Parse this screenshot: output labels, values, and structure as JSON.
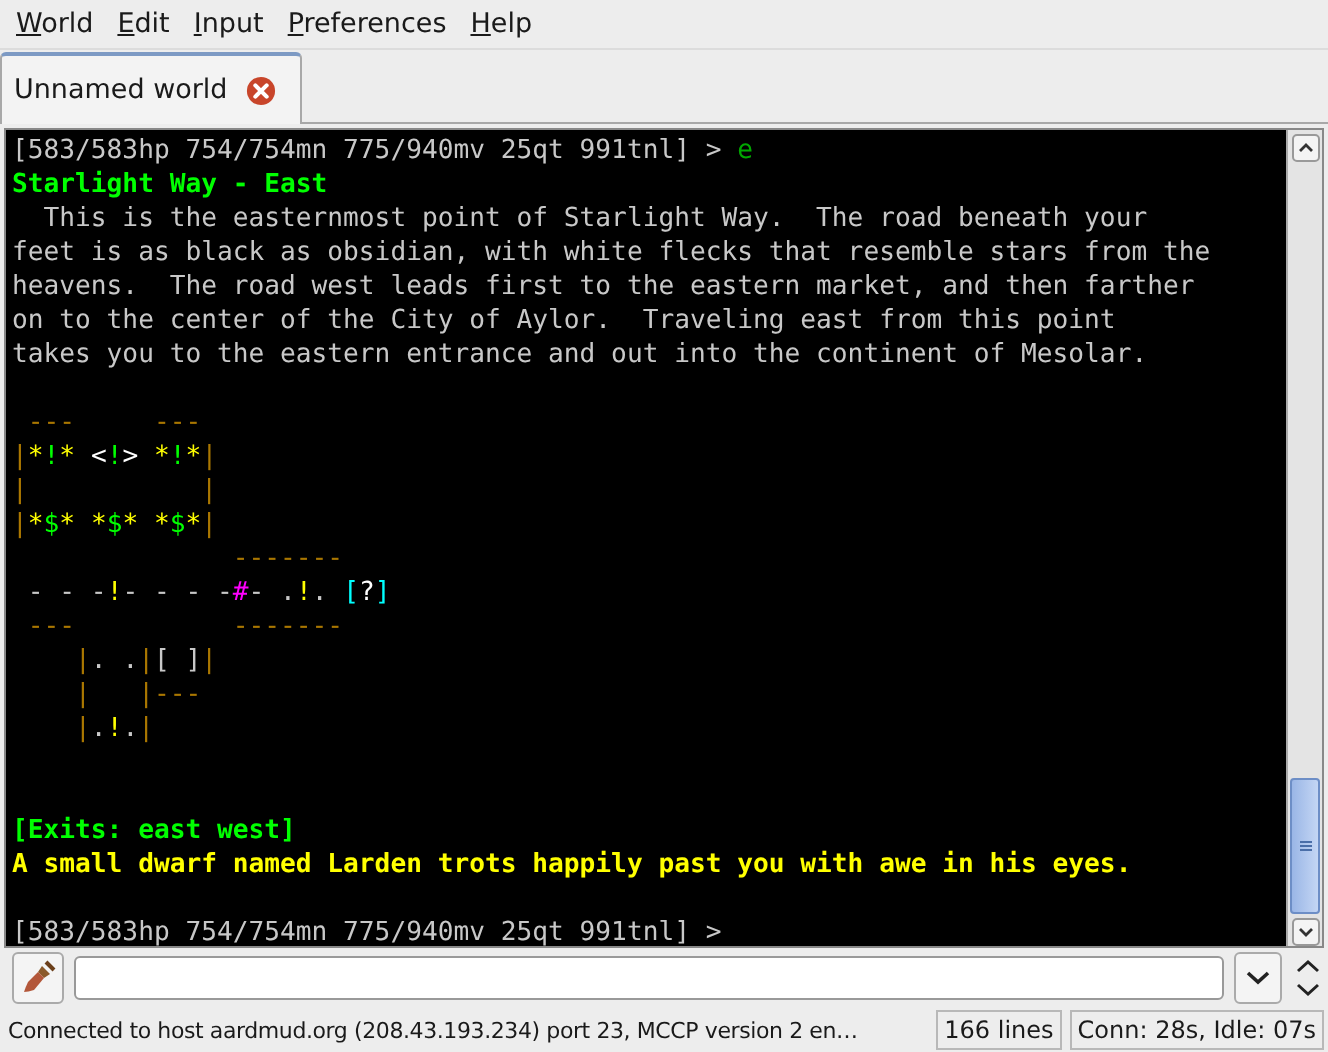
{
  "menu": [
    {
      "label": "World"
    },
    {
      "label": "Edit"
    },
    {
      "label": "Input"
    },
    {
      "label": "Preferences"
    },
    {
      "label": "Help"
    }
  ],
  "tabs": [
    {
      "label": "Unnamed world",
      "selected": true
    }
  ],
  "terminal": {
    "lines": [
      {
        "kind": "text",
        "segments": [
          {
            "text": "[583/583hp 754/754mn 775/940mv 25qt 991tnl] > ",
            "color": "#c8c8c8"
          },
          {
            "text": "e",
            "color": "#00a800"
          }
        ]
      },
      {
        "kind": "text",
        "segments": [
          {
            "text": "Starlight Way - East",
            "color": "#00ff00",
            "bold": true
          }
        ]
      },
      {
        "kind": "text",
        "segments": [
          {
            "text": "  This is the easternmost point of Starlight Way.  The road beneath your",
            "color": "#c8c8c8"
          }
        ]
      },
      {
        "kind": "text",
        "segments": [
          {
            "text": "feet is as black as obsidian, with white flecks that resemble stars from the",
            "color": "#c8c8c8"
          }
        ]
      },
      {
        "kind": "text",
        "segments": [
          {
            "text": "heavens.  The road west leads first to the eastern market, and then farther",
            "color": "#c8c8c8"
          }
        ]
      },
      {
        "kind": "text",
        "segments": [
          {
            "text": "on to the center of the City of Aylor.  Traveling east from this point",
            "color": "#c8c8c8"
          }
        ]
      },
      {
        "kind": "text",
        "segments": [
          {
            "text": "takes you to the eastern entrance and out into the continent of Mesolar.",
            "color": "#c8c8c8"
          }
        ]
      },
      {
        "kind": "blank"
      },
      {
        "kind": "text",
        "segments": [
          {
            "text": " ---     ---",
            "color": "#aa7700"
          }
        ]
      },
      {
        "kind": "text",
        "segments": [
          {
            "text": "|",
            "color": "#aa7700"
          },
          {
            "text": "*",
            "color": "#ffff00"
          },
          {
            "text": "!",
            "color": "#00ff00"
          },
          {
            "text": "*",
            "color": "#ffff00"
          },
          {
            "text": " <",
            "color": "#ffffff"
          },
          {
            "text": "!",
            "color": "#00ff00"
          },
          {
            "text": ">",
            "color": "#ffffff"
          },
          {
            "text": " *",
            "color": "#ffff00"
          },
          {
            "text": "!",
            "color": "#00ff00"
          },
          {
            "text": "*",
            "color": "#ffff00"
          },
          {
            "text": "|",
            "color": "#aa7700"
          }
        ]
      },
      {
        "kind": "text",
        "segments": [
          {
            "text": "|           |",
            "color": "#aa7700"
          }
        ]
      },
      {
        "kind": "text",
        "segments": [
          {
            "text": "|",
            "color": "#aa7700"
          },
          {
            "text": "*",
            "color": "#ffff00"
          },
          {
            "text": "$",
            "color": "#00ff00"
          },
          {
            "text": "* *",
            "color": "#ffff00"
          },
          {
            "text": "$",
            "color": "#00ff00"
          },
          {
            "text": "* *",
            "color": "#ffff00"
          },
          {
            "text": "$",
            "color": "#00ff00"
          },
          {
            "text": "*",
            "color": "#ffff00"
          },
          {
            "text": "|",
            "color": "#aa7700"
          }
        ]
      },
      {
        "kind": "text",
        "segments": [
          {
            "text": "              -------",
            "color": "#aa7700"
          }
        ]
      },
      {
        "kind": "text",
        "segments": [
          {
            "text": " - - -",
            "color": "#c8c8c8"
          },
          {
            "text": "!",
            "color": "#ffff00"
          },
          {
            "text": "- - - -",
            "color": "#c8c8c8"
          },
          {
            "text": "#",
            "color": "#ff00ff"
          },
          {
            "text": "- .",
            "color": "#c8c8c8"
          },
          {
            "text": "!",
            "color": "#ffff00"
          },
          {
            "text": ".",
            "color": "#c8c8c8"
          },
          {
            "text": " [",
            "color": "#00ffff"
          },
          {
            "text": "?",
            "color": "#ffffff"
          },
          {
            "text": "]",
            "color": "#00ffff"
          }
        ]
      },
      {
        "kind": "text",
        "segments": [
          {
            "text": " ---          -------",
            "color": "#aa7700"
          }
        ]
      },
      {
        "kind": "text",
        "segments": [
          {
            "text": "    |",
            "color": "#aa7700"
          },
          {
            "text": ". .",
            "color": "#c8c8c8"
          },
          {
            "text": "|",
            "color": "#aa7700"
          },
          {
            "text": "[ ]",
            "color": "#c8c8c8"
          },
          {
            "text": "|",
            "color": "#aa7700"
          }
        ]
      },
      {
        "kind": "text",
        "segments": [
          {
            "text": "    |   |---",
            "color": "#aa7700"
          }
        ]
      },
      {
        "kind": "text",
        "segments": [
          {
            "text": "    |",
            "color": "#aa7700"
          },
          {
            "text": ".",
            "color": "#c8c8c8"
          },
          {
            "text": "!",
            "color": "#ffff00"
          },
          {
            "text": ".",
            "color": "#c8c8c8"
          },
          {
            "text": "|",
            "color": "#aa7700"
          }
        ]
      },
      {
        "kind": "blank"
      },
      {
        "kind": "blank"
      },
      {
        "kind": "text",
        "segments": [
          {
            "text": "[Exits: east west]",
            "color": "#00ff00",
            "bold": true
          }
        ]
      },
      {
        "kind": "text",
        "segments": [
          {
            "text": "A small dwarf named Larden trots happily past you with awe in his eyes.",
            "color": "#ffff00",
            "bold": true
          }
        ]
      },
      {
        "kind": "blank"
      },
      {
        "kind": "text",
        "segments": [
          {
            "text": "[583/583hp 754/754mn 775/940mv 25qt 991tnl] > ",
            "color": "#c8c8c8"
          }
        ]
      }
    ]
  },
  "status_bar": {
    "message": "Connected to host aardmud.org (208.43.193.234) port 23, MCCP version 2 en…",
    "lines": "166 lines",
    "timer": "Conn: 28s, Idle: 07s"
  }
}
